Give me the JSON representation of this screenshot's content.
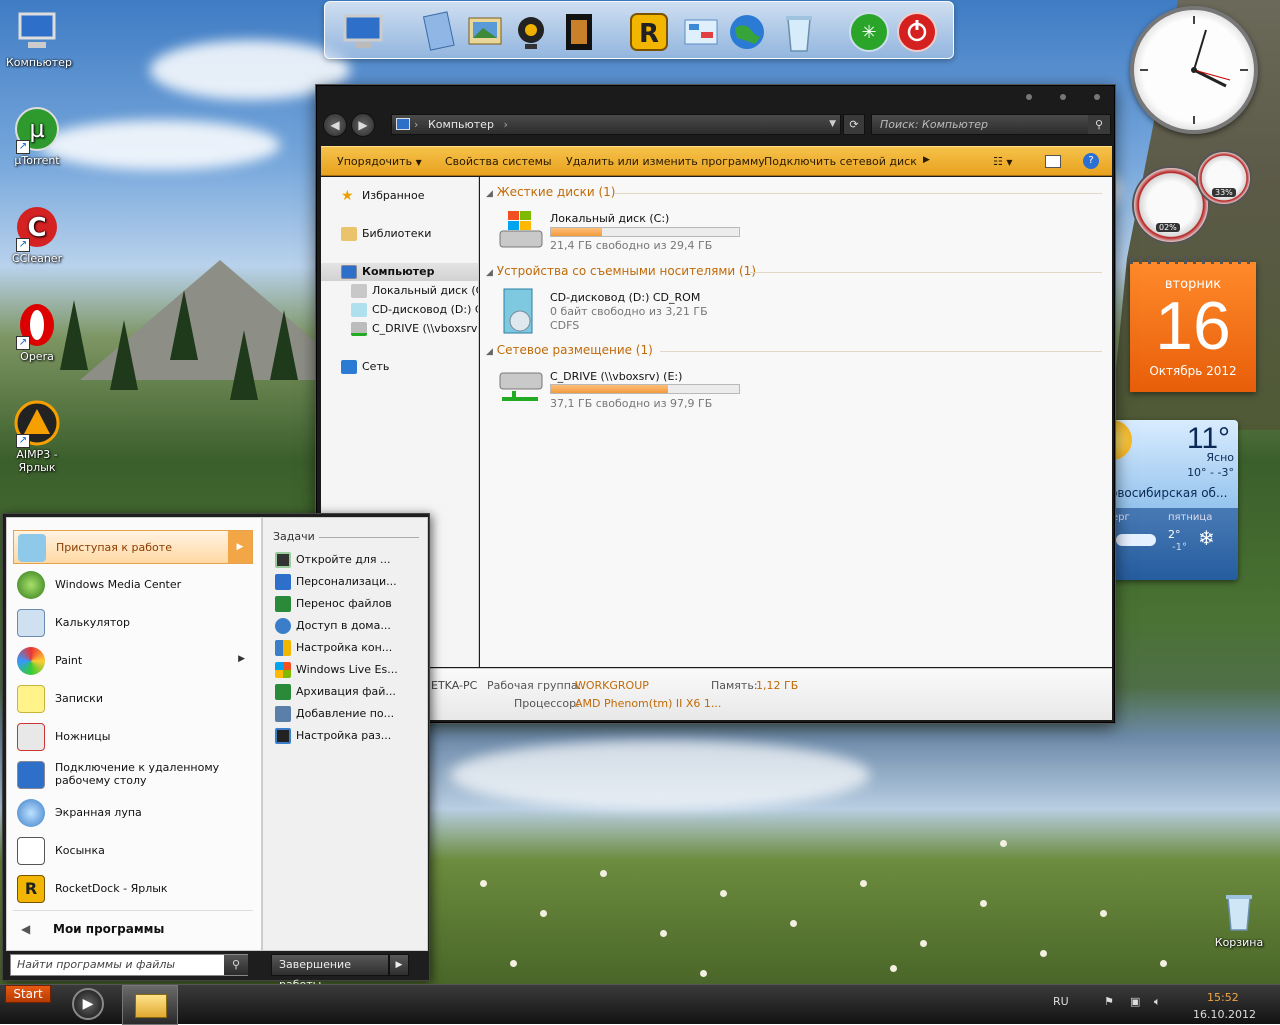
{
  "desktop": {
    "icons": [
      {
        "label": "Компьютер",
        "icon": "computer-icon"
      },
      {
        "label": "µTorrent",
        "icon": "utorrent-icon"
      },
      {
        "label": "CCleaner",
        "icon": "ccleaner-icon"
      },
      {
        "label": "Opera",
        "icon": "opera-icon"
      },
      {
        "label": "AIMP3 - Ярлык",
        "icon": "aimp-icon"
      }
    ],
    "recycle_bin": "Корзина"
  },
  "explorer": {
    "address": "Компьютер",
    "search_placeholder": "Поиск: Компьютер",
    "toolbar": {
      "organize": "Упорядочить",
      "system_props": "Свойства системы",
      "uninstall": "Удалить или изменить программу",
      "map_drive": "Подключить сетевой диск"
    },
    "nav": {
      "favorites": "Избранное",
      "libraries": "Библиотеки",
      "computer": "Компьютер",
      "local_disk": "Локальный диск (C:)",
      "cd_drive": "CD-дисковод (D:) CD",
      "c_drive": "C_DRIVE (\\\\vboxsrv) (",
      "network": "Сеть"
    },
    "groups": [
      {
        "title": "Жесткие диски (1)",
        "items": [
          {
            "name": "Локальный диск (C:)",
            "info": "21,4 ГБ свободно из 29,4 ГБ",
            "fill": 0.27
          }
        ]
      },
      {
        "title": "Устройства со съемными носителями (1)",
        "items": [
          {
            "name": "CD-дисковод (D:) CD_ROM",
            "info": "0 байт свободно из 3,21 ГБ",
            "fs": "CDFS"
          }
        ]
      },
      {
        "title": "Сетевое размещение (1)",
        "items": [
          {
            "name": "C_DRIVE (\\\\vboxsrv) (E:)",
            "info": "37,1 ГБ свободно из 97,9 ГБ",
            "fill": 0.62
          }
        ]
      }
    ],
    "details": {
      "pc_name": "ETKA-PC",
      "workgroup_label": "Рабочая группа:",
      "workgroup": "WORKGROUP",
      "memory_label": "Память:",
      "memory": "1,12 ГБ",
      "cpu_label": "Процессор:",
      "cpu": "AMD Phenom(tm) II X6 1..."
    }
  },
  "start_menu": {
    "items": [
      {
        "label": "Приступая к работе"
      },
      {
        "label": "Windows Media Center"
      },
      {
        "label": "Калькулятор"
      },
      {
        "label": "Paint"
      },
      {
        "label": "Записки"
      },
      {
        "label": "Ножницы"
      },
      {
        "label": "Подключение к удаленному рабочему столу"
      },
      {
        "label": "Экранная лупа"
      },
      {
        "label": "Косынка"
      },
      {
        "label": "RocketDock - Ярлык"
      }
    ],
    "all_programs": "Мои программы",
    "tasks_header": "Задачи",
    "tasks": [
      "Откройте для ...",
      "Персонализаци...",
      "Перенос файлов",
      "Доступ в дома...",
      "Настройка кон...",
      "Windows Live Es...",
      "Архивация фай...",
      "Добавление по...",
      "Настройка раз..."
    ],
    "search_placeholder": "Найти программы и файлы",
    "shutdown": "Завершение работы"
  },
  "taskbar": {
    "start": "Start",
    "lang": "RU",
    "time": "15:52",
    "date": "16.10.2012"
  },
  "gadgets": {
    "calendar": {
      "weekday": "вторник",
      "day": "16",
      "month_year": "Октябрь 2012"
    },
    "weather": {
      "temp": "11°",
      "condition": "Ясно",
      "range": "10° - -3°",
      "city": "овосибирская об...",
      "day1": "ерг",
      "day2": "пятница",
      "d2_hi": "2°",
      "d2_lo": "-1°"
    },
    "meter": {
      "cpu": "02%",
      "ram": "33%"
    }
  },
  "colors": {
    "accent": "#e8a21f",
    "calendar": "#e85e0a",
    "group_title": "#c06a08"
  }
}
